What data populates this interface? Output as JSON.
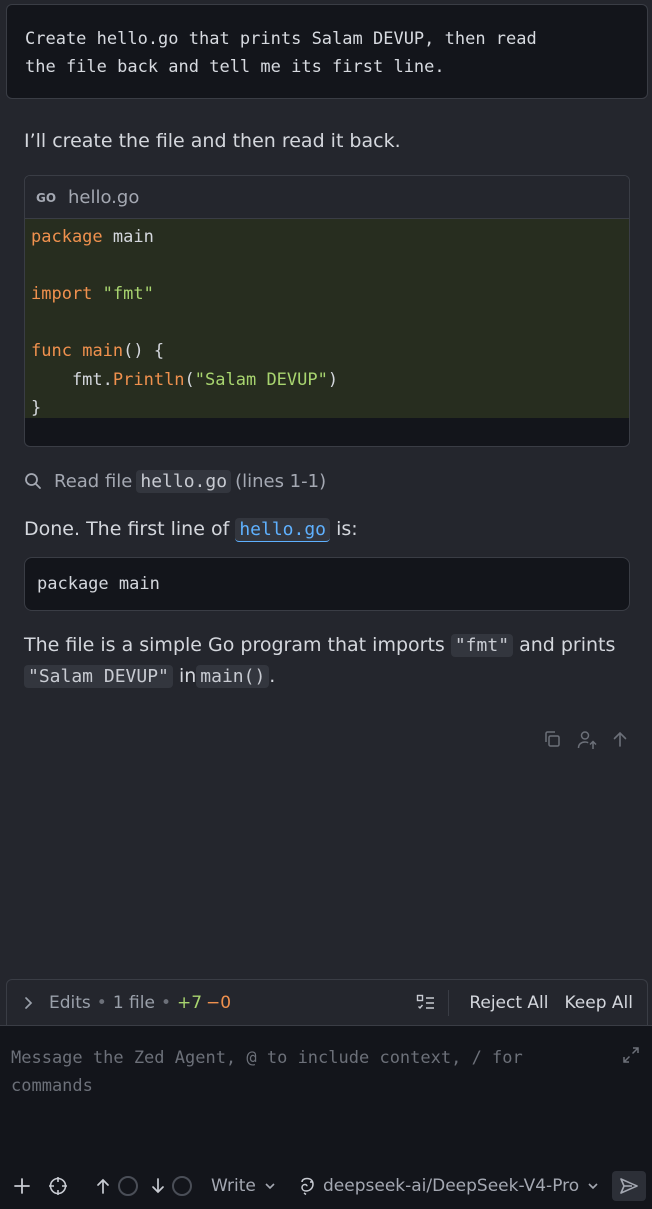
{
  "user_message": "Create hello.go that prints Salam DEVUP, then read\nthe file back and tell me its first line.",
  "assistant": {
    "intro": "I’ll create the file and then read it back.",
    "code_file": {
      "filename": "hello.go",
      "lines": [
        {
          "parts": [
            {
              "t": "package",
              "c": "kw"
            },
            {
              "t": " main",
              "c": ""
            }
          ]
        },
        {
          "parts": []
        },
        {
          "parts": [
            {
              "t": "import",
              "c": "kw"
            },
            {
              "t": " ",
              "c": ""
            },
            {
              "t": "\"fmt\"",
              "c": "str"
            }
          ]
        },
        {
          "parts": []
        },
        {
          "parts": [
            {
              "t": "func",
              "c": "kw"
            },
            {
              "t": " ",
              "c": ""
            },
            {
              "t": "main",
              "c": "fn"
            },
            {
              "t": "() {",
              "c": ""
            }
          ]
        },
        {
          "parts": [
            {
              "t": "    fmt.",
              "c": ""
            },
            {
              "t": "Println",
              "c": "fn"
            },
            {
              "t": "(",
              "c": ""
            },
            {
              "t": "\"Salam DEVUP\"",
              "c": "str"
            },
            {
              "t": ")",
              "c": ""
            }
          ]
        },
        {
          "parts": [
            {
              "t": "}",
              "c": ""
            }
          ]
        }
      ]
    },
    "tool_call": {
      "prefix": "Read file",
      "file": "hello.go",
      "suffix": "(lines 1-1)"
    },
    "done_prefix": "Done. The first line of",
    "done_file": "hello.go",
    "done_suffix": "is:",
    "first_line": "package main",
    "summary_prefix": "The file is a simple Go program that imports",
    "summary_chip1": "\"fmt\"",
    "summary_mid": "and prints",
    "summary_chip2": "\"Salam DEVUP\"",
    "summary_in": "in",
    "summary_chip3": "main()",
    "summary_end": "."
  },
  "edits_bar": {
    "label": "Edits",
    "files": "1 file",
    "added": "+7",
    "removed": "−0",
    "reject_label": "Reject All",
    "keep_label": "Keep All"
  },
  "composer": {
    "placeholder": "Message the Zed Agent, @ to include context, / for commands",
    "mode_label": "Write",
    "model_label": "deepseek-ai/DeepSeek-V4-Pro"
  },
  "colors": {
    "background": "#24262d",
    "panel": "#13151b",
    "code_bg": "#272d1f",
    "keyword": "#f0914e",
    "string": "#a8d46f",
    "link": "#5fb1ff"
  }
}
